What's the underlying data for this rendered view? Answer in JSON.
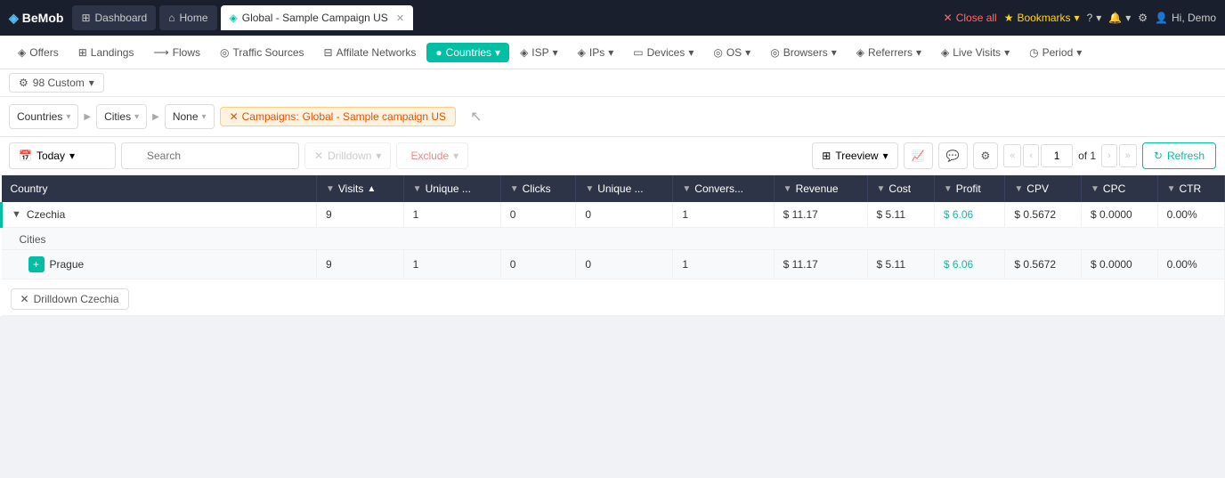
{
  "brand": {
    "icon": "◈",
    "name": "BeMob"
  },
  "topnav": {
    "close_all": "Close all",
    "bookmarks": "Bookmarks",
    "help": "?",
    "user": "Hi, Demo",
    "dashboard_btn": "Dashboard",
    "home_btn": "Home",
    "tab_title": "Global - Sample Campaign US",
    "close_tab": "✕"
  },
  "secnav": {
    "items": [
      {
        "label": "Offers",
        "icon": "◈"
      },
      {
        "label": "Landings",
        "icon": "⊞"
      },
      {
        "label": "Flows",
        "icon": "⟶"
      },
      {
        "label": "Traffic Sources",
        "icon": "◎"
      },
      {
        "label": "Affilate Networks",
        "icon": "⊟"
      },
      {
        "label": "Countries",
        "icon": "●",
        "active": true
      },
      {
        "label": "ISP",
        "icon": "◈"
      },
      {
        "label": "IPs",
        "icon": "◈"
      },
      {
        "label": "Devices",
        "icon": "▭"
      },
      {
        "label": "OS",
        "icon": "◎"
      },
      {
        "label": "Browsers",
        "icon": "◎"
      },
      {
        "label": "Referrers",
        "icon": "◈"
      },
      {
        "label": "Live Visits",
        "icon": "◈"
      },
      {
        "label": "Period",
        "icon": "◈"
      }
    ]
  },
  "custom": {
    "label": "98 Custom"
  },
  "filters": {
    "group1": "Countries",
    "group2": "Cities",
    "group3": "None",
    "campaign_label": "Campaigns:",
    "campaign_name": "Global - Sample campaign US",
    "cursor": "↖"
  },
  "toolbar": {
    "date": "Today",
    "search_placeholder": "Search",
    "drilldown_label": "Drilldown",
    "exclude_label": "Exclude",
    "treeview_label": "Treeview",
    "page_current": "1",
    "page_of": "of 1",
    "refresh_label": "Refresh"
  },
  "table": {
    "columns": [
      {
        "key": "country",
        "label": "Country"
      },
      {
        "key": "visits",
        "label": "Visits"
      },
      {
        "key": "unique",
        "label": "Unique ..."
      },
      {
        "key": "clicks",
        "label": "Clicks"
      },
      {
        "key": "unique2",
        "label": "Unique ..."
      },
      {
        "key": "convers",
        "label": "Convers..."
      },
      {
        "key": "revenue",
        "label": "Revenue"
      },
      {
        "key": "cost",
        "label": "Cost"
      },
      {
        "key": "profit",
        "label": "Profit"
      },
      {
        "key": "cpv",
        "label": "CPV"
      },
      {
        "key": "cpc",
        "label": "CPC"
      },
      {
        "key": "ctr",
        "label": "CTR"
      }
    ],
    "rows": [
      {
        "country": "Czechia",
        "visits": "9",
        "unique": "1",
        "clicks": "0",
        "unique2": "0",
        "convers": "1",
        "revenue": "$ 11.17",
        "cost": "$ 5.11",
        "profit": "$ 6.06",
        "cpv": "$ 0.5672",
        "cpc": "$ 0.0000",
        "ctr": "0.00%",
        "expanded": true,
        "cities": [
          {
            "city": "Prague",
            "visits": "9",
            "unique": "1",
            "clicks": "0",
            "unique2": "0",
            "convers": "1",
            "revenue": "$ 11.17",
            "cost": "$ 5.11",
            "profit": "$ 6.06",
            "cpv": "$ 0.5672",
            "cpc": "$ 0.0000",
            "ctr": "0.00%"
          }
        ]
      }
    ],
    "drilldown_btn": "Drilldown Czechia"
  }
}
